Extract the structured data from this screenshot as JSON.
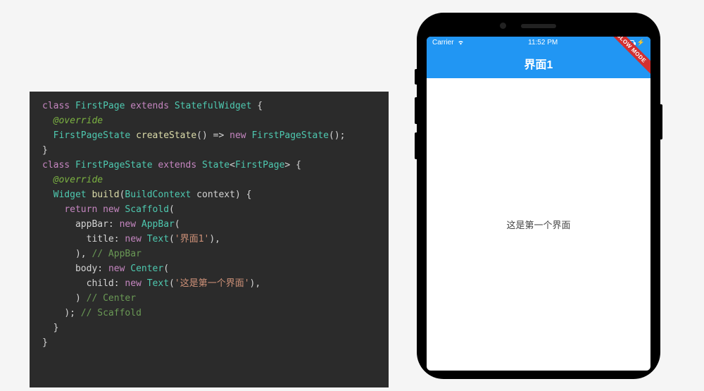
{
  "code": {
    "lines": [
      {
        "indent": 0,
        "tokens": [
          {
            "t": "class ",
            "c": "kw"
          },
          {
            "t": "FirstPage ",
            "c": "cls"
          },
          {
            "t": "extends ",
            "c": "kw"
          },
          {
            "t": "StatefulWidget ",
            "c": "cls"
          },
          {
            "t": "{",
            "c": "punc"
          }
        ]
      },
      {
        "indent": 1,
        "tokens": [
          {
            "t": "@override",
            "c": "ann"
          }
        ]
      },
      {
        "indent": 1,
        "tokens": [
          {
            "t": "FirstPageState ",
            "c": "cls"
          },
          {
            "t": "createState",
            "c": "fn"
          },
          {
            "t": "() ",
            "c": "paren"
          },
          {
            "t": "=> ",
            "c": "punc"
          },
          {
            "t": "new ",
            "c": "new"
          },
          {
            "t": "FirstPageState",
            "c": "cls"
          },
          {
            "t": "();",
            "c": "punc"
          }
        ]
      },
      {
        "indent": 0,
        "tokens": [
          {
            "t": "}",
            "c": "punc"
          }
        ]
      },
      {
        "indent": 0,
        "tokens": []
      },
      {
        "indent": 0,
        "tokens": [
          {
            "t": "class ",
            "c": "kw"
          },
          {
            "t": "FirstPageState ",
            "c": "cls"
          },
          {
            "t": "extends ",
            "c": "kw"
          },
          {
            "t": "State",
            "c": "cls"
          },
          {
            "t": "<",
            "c": "punc"
          },
          {
            "t": "FirstPage",
            "c": "cls"
          },
          {
            "t": "> {",
            "c": "punc"
          }
        ]
      },
      {
        "indent": 0,
        "tokens": []
      },
      {
        "indent": 1,
        "tokens": [
          {
            "t": "@override",
            "c": "ann"
          }
        ]
      },
      {
        "indent": 1,
        "tokens": [
          {
            "t": "Widget ",
            "c": "type"
          },
          {
            "t": "build",
            "c": "fn"
          },
          {
            "t": "(",
            "c": "paren"
          },
          {
            "t": "BuildContext ",
            "c": "type"
          },
          {
            "t": "context",
            "c": "punc"
          },
          {
            "t": ") {",
            "c": "punc"
          }
        ]
      },
      {
        "indent": 2,
        "tokens": [
          {
            "t": "return ",
            "c": "kw"
          },
          {
            "t": "new ",
            "c": "new"
          },
          {
            "t": "Scaffold",
            "c": "cls"
          },
          {
            "t": "(",
            "c": "paren"
          }
        ]
      },
      {
        "indent": 3,
        "tokens": [
          {
            "t": "appBar: ",
            "c": "punc"
          },
          {
            "t": "new ",
            "c": "new"
          },
          {
            "t": "AppBar",
            "c": "cls"
          },
          {
            "t": "(",
            "c": "paren"
          }
        ]
      },
      {
        "indent": 4,
        "tokens": [
          {
            "t": "title: ",
            "c": "punc"
          },
          {
            "t": "new ",
            "c": "new"
          },
          {
            "t": "Text",
            "c": "cls"
          },
          {
            "t": "(",
            "c": "paren"
          },
          {
            "t": "'界面1'",
            "c": "str"
          },
          {
            "t": "),",
            "c": "paren"
          }
        ]
      },
      {
        "indent": 3,
        "tokens": [
          {
            "t": "), ",
            "c": "paren"
          },
          {
            "t": "// AppBar",
            "c": "cmt"
          }
        ]
      },
      {
        "indent": 3,
        "tokens": [
          {
            "t": "body: ",
            "c": "punc"
          },
          {
            "t": "new ",
            "c": "new"
          },
          {
            "t": "Center",
            "c": "cls"
          },
          {
            "t": "(",
            "c": "paren"
          }
        ]
      },
      {
        "indent": 4,
        "tokens": [
          {
            "t": "child: ",
            "c": "punc"
          },
          {
            "t": "new ",
            "c": "new"
          },
          {
            "t": "Text",
            "c": "cls"
          },
          {
            "t": "(",
            "c": "paren"
          },
          {
            "t": "'这是第一个界面'",
            "c": "str"
          },
          {
            "t": "),",
            "c": "paren"
          }
        ]
      },
      {
        "indent": 3,
        "tokens": [
          {
            "t": ") ",
            "c": "paren"
          },
          {
            "t": "// Center",
            "c": "cmt"
          }
        ]
      },
      {
        "indent": 2,
        "tokens": [
          {
            "t": "); ",
            "c": "paren"
          },
          {
            "t": "// Scaffold",
            "c": "cmt"
          }
        ]
      },
      {
        "indent": 1,
        "tokens": [
          {
            "t": "}",
            "c": "punc"
          }
        ]
      },
      {
        "indent": 0,
        "tokens": [
          {
            "t": "}",
            "c": "punc"
          }
        ]
      }
    ]
  },
  "phone": {
    "status": {
      "carrier": "Carrier",
      "time": "11:52 PM"
    },
    "appBarTitle": "界面1",
    "bodyText": "这是第一个界面",
    "banner": "SLOW MODE"
  }
}
